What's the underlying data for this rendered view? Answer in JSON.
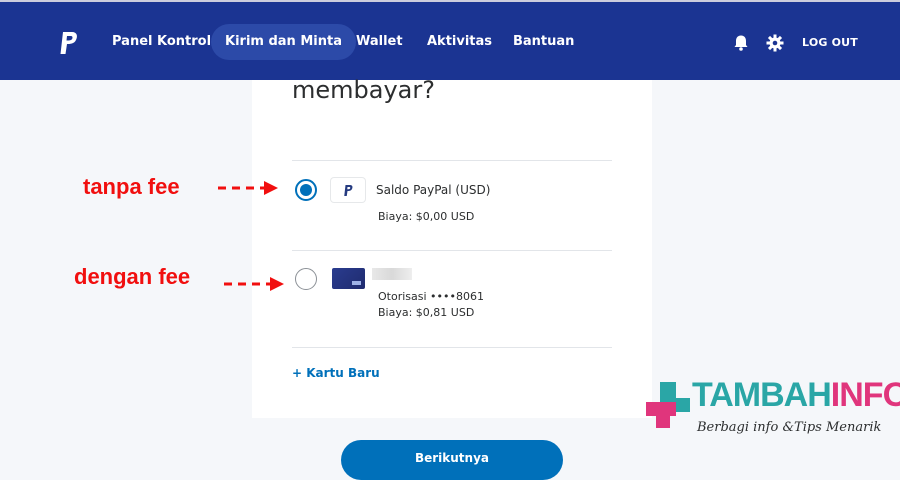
{
  "nav": {
    "items": [
      {
        "label": "Panel Kontrol"
      },
      {
        "label": "Kirim dan Minta"
      },
      {
        "label": "Wallet"
      },
      {
        "label": "Aktivitas"
      },
      {
        "label": "Bantuan"
      }
    ],
    "logout_label": "LOG OUT",
    "icons": [
      "paypal-logo-icon",
      "bell-icon",
      "gear-icon"
    ]
  },
  "main": {
    "heading": "membayar?",
    "options": [
      {
        "name": "Saldo PayPal (USD)",
        "fee": "Biaya: $0,00 USD",
        "selected": true
      },
      {
        "auth": "Otorisasi ••••8061",
        "fee": "Biaya: $0,81 USD",
        "selected": false
      }
    ],
    "add_card_label": "+ Kartu Baru",
    "next_button_label": "Berikutnya"
  },
  "annotations": {
    "no_fee": "tanpa fee",
    "with_fee": "dengan fee"
  },
  "watermark": {
    "brand_part1": "TAMBAH",
    "brand_part2": "INFO",
    "tagline": "Berbagi info &Tips Menarik"
  },
  "colors": {
    "nav_bg": "#1b3492",
    "accent": "#0070ba",
    "annotation": "#f10f0f",
    "brand_teal": "#2aa6a6",
    "brand_pink": "#e0357c"
  }
}
